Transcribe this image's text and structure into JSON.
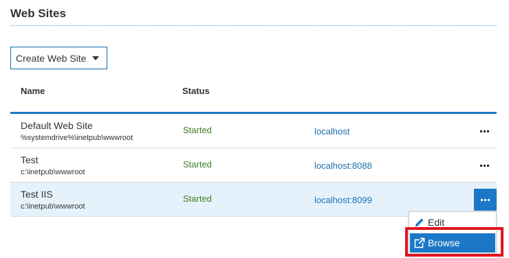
{
  "page": {
    "title": "Web Sites"
  },
  "toolbar": {
    "create_label": "Create Web Site"
  },
  "columns": {
    "name": "Name",
    "status": "Status"
  },
  "sites": [
    {
      "name": "Default Web Site",
      "path": "%systemdrive%\\inetpub\\wwwroot",
      "status": "Started",
      "binding": "localhost"
    },
    {
      "name": "Test",
      "path": "c:\\inetpub\\wwwroot",
      "status": "Started",
      "binding": "localhost:8088"
    },
    {
      "name": "Test IIS",
      "path": "c:\\inetpub\\wwwroot",
      "status": "Started",
      "binding": "localhost:8099"
    }
  ],
  "context_menu": {
    "edit": "Edit",
    "browse": "Browse"
  },
  "icons": {
    "more": "more-horizontal-icon",
    "edit": "pencil-icon",
    "browse": "external-link-icon",
    "caret": "caret-down-icon"
  },
  "colors": {
    "accent": "#1b78c6",
    "status_ok": "#3b7d23",
    "link": "#1b6fb0",
    "highlight": "#e0141e",
    "selected_row": "#e6f2fb"
  }
}
